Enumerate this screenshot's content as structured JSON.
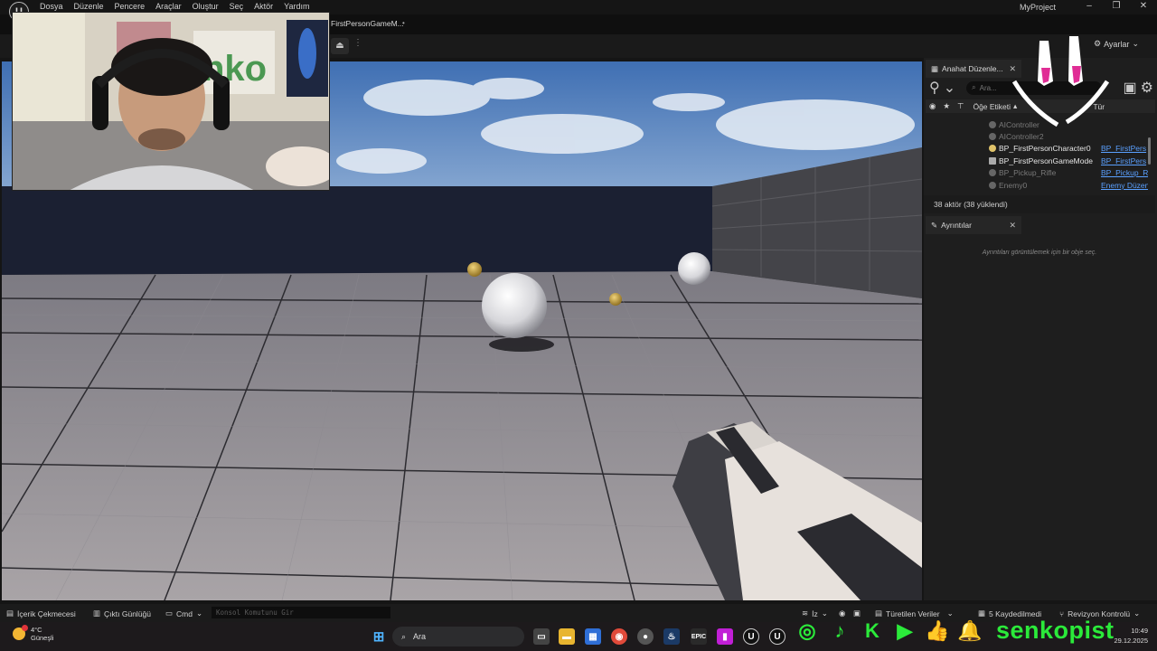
{
  "menu": [
    "Dosya",
    "Düzenle",
    "Pencere",
    "Araçlar",
    "Oluştur",
    "Seç",
    "Aktör",
    "Yardım"
  ],
  "project_name": "MyProject",
  "tab": {
    "label": "FirstPersonGameM...",
    "modified": "•"
  },
  "toolbar": {
    "settings_label": "Ayarlar"
  },
  "outliner": {
    "tab_label": "Anahat Düzenle...",
    "search_placeholder": "Ara...",
    "col_label": "Öğe Etiketi",
    "col_type": "Tür",
    "rows": [
      {
        "name": "AIController",
        "type": "",
        "dim": true
      },
      {
        "name": "AIController2",
        "type": "",
        "dim": true
      },
      {
        "name": "BP_FirstPersonCharacter0",
        "type": "BP_FirstPers",
        "dim": false
      },
      {
        "name": "BP_FirstPersonGameMode",
        "type": "BP_FirstPers",
        "dim": false
      },
      {
        "name": "BP_Pickup_Rifle",
        "type": "BP_Pickup_R",
        "dim": true
      },
      {
        "name": "Enemy0",
        "type": "Enemy Düzen",
        "dim": true
      }
    ],
    "actor_count": "38 aktör (38 yüklendi)"
  },
  "details": {
    "tab_label": "Ayrıntılar",
    "empty_text": "Ayrıntıları görüntülemek için bir obje seç."
  },
  "statusbar": {
    "content_drawer": "İçerik Çekmecesi",
    "output_log": "Çıktı Günlüğü",
    "cmd": "Cmd",
    "console_placeholder": "Konsol Komutunu Gir",
    "trace": "İz",
    "derived_data": "Türetilen Veriler",
    "unsaved": "5 Kaydedilmedi",
    "revision": "Revizyon Kontrolü"
  },
  "taskbar": {
    "temp": "4°C",
    "weather": "Güneşli",
    "search": "Ara",
    "time": "10:49",
    "date": "29.12.2025"
  },
  "overlay": {
    "brand": "senkopist"
  }
}
